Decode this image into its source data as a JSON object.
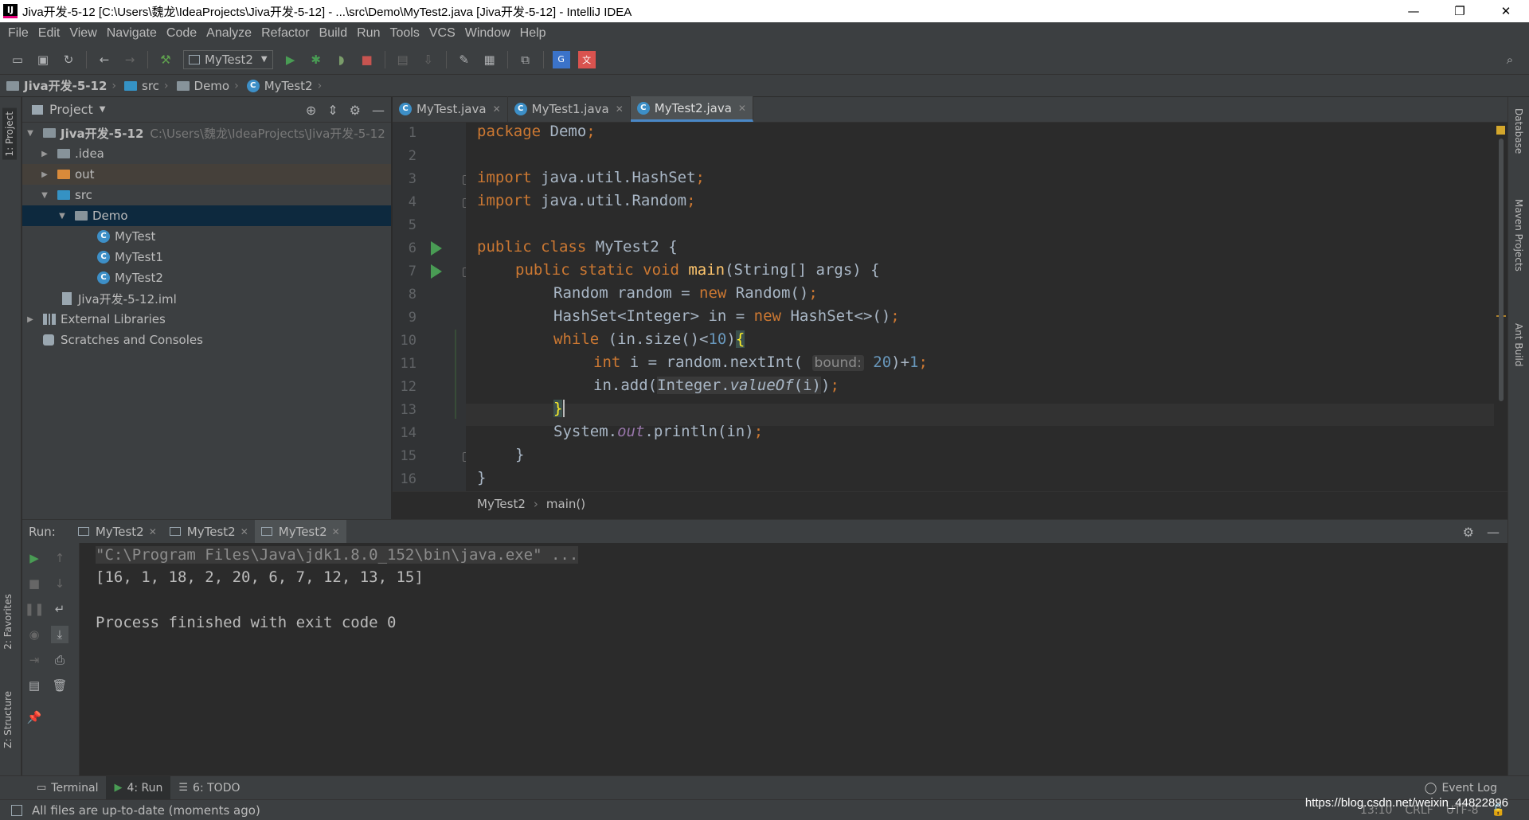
{
  "window": {
    "title": "Jiva开发-5-12 [C:\\Users\\魏龙\\IdeaProjects\\Jiva开发-5-12] - ...\\src\\Demo\\MyTest2.java [Jiva开发-5-12] - IntelliJ IDEA",
    "minimize": "—",
    "restore": "❐",
    "close": "✕"
  },
  "menu": [
    "File",
    "Edit",
    "View",
    "Navigate",
    "Code",
    "Analyze",
    "Refactor",
    "Build",
    "Run",
    "Tools",
    "VCS",
    "Window",
    "Help"
  ],
  "toolbar": {
    "run_config": "MyTest2"
  },
  "breadcrumb": [
    "Jiva开发-5-12",
    "src",
    "Demo",
    "MyTest2"
  ],
  "project_panel": {
    "title": "Project",
    "tree": [
      {
        "label": "Jiva开发-5-12",
        "path": "C:\\Users\\魏龙\\IdeaProjects\\Jiva开发-5-12"
      },
      {
        "label": ".idea"
      },
      {
        "label": "out"
      },
      {
        "label": "src"
      },
      {
        "label": "Demo"
      },
      {
        "label": "MyTest"
      },
      {
        "label": "MyTest1"
      },
      {
        "label": "MyTest2"
      },
      {
        "label": "Jiva开发-5-12.iml"
      },
      {
        "label": "External Libraries"
      },
      {
        "label": "Scratches and Consoles"
      }
    ]
  },
  "left_stripe": {
    "project": "1: Project",
    "favorites": "2: Favorites",
    "structure": "Z: Structure"
  },
  "right_stripe": {
    "database": "Database",
    "maven": "Maven Projects",
    "ant": "Ant Build"
  },
  "editor": {
    "tabs": [
      {
        "label": "MyTest.java"
      },
      {
        "label": "MyTest1.java"
      },
      {
        "label": "MyTest2.java"
      }
    ],
    "active_tab": 2,
    "line_numbers": [
      "1",
      "2",
      "3",
      "4",
      "5",
      "6",
      "7",
      "8",
      "9",
      "10",
      "11",
      "12",
      "13",
      "14",
      "15",
      "16"
    ],
    "code": {
      "l1a": "package",
      "l1b": " Demo",
      "l1c": ";",
      "l3a": "import",
      "l3b": " java.util.HashSet",
      "l3c": ";",
      "l4a": "import",
      "l4b": " java.util.Random",
      "l4c": ";",
      "l6a": "public class",
      "l6b": " MyTest2 {",
      "l7a": "public static void",
      "l7b": " main",
      "l7c": "(String[] args) {",
      "l8a": "Random random = ",
      "l8b": "new",
      "l8c": " Random()",
      "l8d": ";",
      "l9a": "HashSet<Integer> in = ",
      "l9b": "new",
      "l9c": " HashSet<>()",
      "l9d": ";",
      "l10a": "while",
      "l10b": " (in.size()<",
      "l10c": "10",
      "l10d": ")",
      "l10e": "{",
      "l11a": "int",
      "l11b": " i = random.nextInt( ",
      "l11hint": "bound:",
      "l11c": " 20",
      "l11d": ")+",
      "l11e": "1",
      "l11f": ";",
      "l12a": "in.add(",
      "l12b": "Integer.",
      "l12c": "valueOf",
      "l12d": "(i)",
      "l12e": ")",
      "l12f": ";",
      "l13a": "}",
      "l14a": "System.",
      "l14b": "out",
      "l14c": ".println(in)",
      "l14d": ";",
      "l15a": "}",
      "l16a": "}"
    },
    "crumbs": [
      "MyTest2",
      "main()"
    ]
  },
  "run_panel": {
    "label": "Run:",
    "tabs": [
      "MyTest2",
      "MyTest2",
      "MyTest2"
    ],
    "console": [
      "\"C:\\Program Files\\Java\\jdk1.8.0_152\\bin\\java.exe\" ...",
      "[16, 1, 18, 2, 20, 6, 7, 12, 13, 15]",
      "",
      "Process finished with exit code 0"
    ]
  },
  "bottom_tabs": [
    {
      "label": "Terminal"
    },
    {
      "label": "4: Run"
    },
    {
      "label": "6: TODO"
    }
  ],
  "event_log": "Event Log",
  "status": {
    "message": "All files are up-to-date (moments ago)",
    "position": "13:10",
    "line_sep": "CRLF",
    "encoding": "UTF-8"
  },
  "watermark": "https://blog.csdn.net/weixin_44822896",
  "colors": {
    "keyword": "#cc7832",
    "method": "#ffc66d",
    "number": "#6897bb",
    "field": "#9876aa",
    "text": "#a9b7c6",
    "accent": "#4a88c7",
    "run_green": "#499c54"
  }
}
